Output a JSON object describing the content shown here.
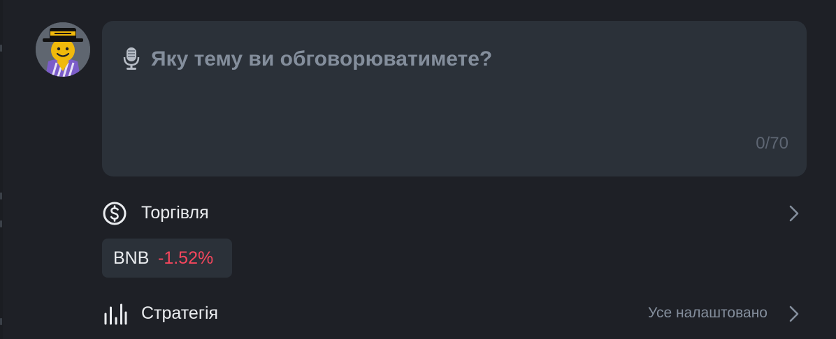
{
  "colors": {
    "background": "#1e2026",
    "card": "#2b3139",
    "text_primary": "#eaecef",
    "text_secondary": "#848e9c",
    "negative": "#f6465d",
    "avatar_yellow": "#f0b90b"
  },
  "composer": {
    "mic_icon": "microphone-icon",
    "placeholder": "Яку тему ви обговорюватимете?",
    "value": "",
    "counter": "0/70"
  },
  "trading": {
    "icon": "dollar-circle-icon",
    "label": "Торгівля",
    "chevron_icon": "chevron-right-icon",
    "tokens": [
      {
        "symbol": "BNB",
        "change": "-1.52%"
      }
    ]
  },
  "strategy": {
    "icon": "bar-chart-icon",
    "label": "Стратегія",
    "value": "Усе налаштовано",
    "chevron_icon": "chevron-right-icon"
  }
}
